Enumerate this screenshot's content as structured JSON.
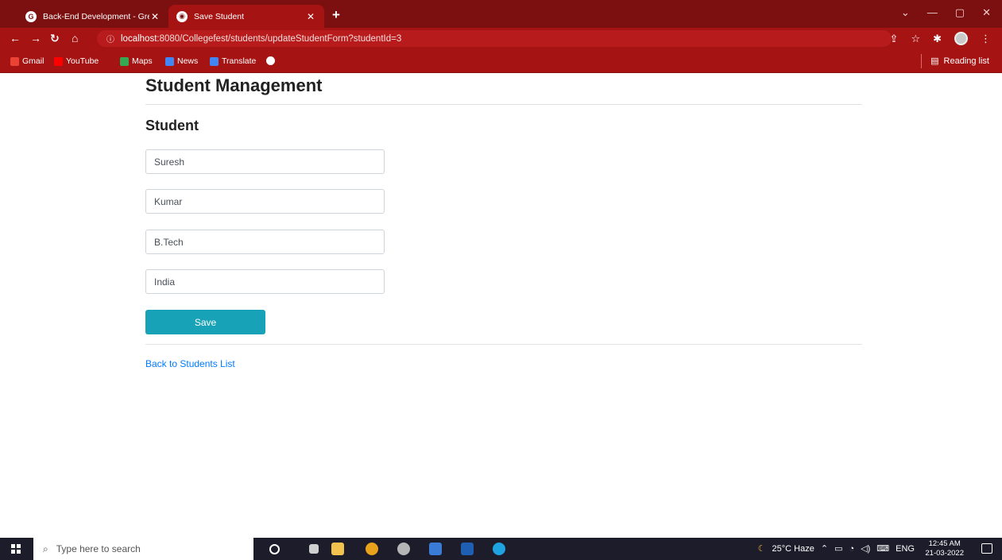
{
  "browser": {
    "tabs": [
      {
        "title": "Back-End Development - Great L",
        "favicon": "G"
      },
      {
        "title": "Save Student",
        "favicon": ""
      }
    ],
    "new_tab_label": "+",
    "url_host": "localhost",
    "url_rest": ":8080/Collegefest/students/updateStudentForm?studentId=3",
    "bookmarks": [
      {
        "label": "Gmail",
        "color": "#ea4335"
      },
      {
        "label": "YouTube",
        "color": "#ff0000"
      },
      {
        "label": "Maps",
        "color": "#34a853"
      },
      {
        "label": "News",
        "color": "#4285f4"
      },
      {
        "label": "Translate",
        "color": "#4285f4"
      }
    ],
    "reading_list": "Reading list"
  },
  "page": {
    "heading": "Student Management",
    "subheading": "Student",
    "fields": {
      "first_name": "Suresh",
      "last_name": "Kumar",
      "course": "B.Tech",
      "country": "India"
    },
    "save_label": "Save",
    "back_link": "Back to Students List"
  },
  "taskbar": {
    "search_placeholder": "Type here to search",
    "weather": "25°C Haze",
    "lang": "ENG",
    "time": "12:45 AM",
    "date": "21-03-2022"
  },
  "colors": {
    "tab_bar": "#7c0f0f",
    "toolbar": "#a61313",
    "save_button": "#17a2b8",
    "link": "#007bff"
  }
}
